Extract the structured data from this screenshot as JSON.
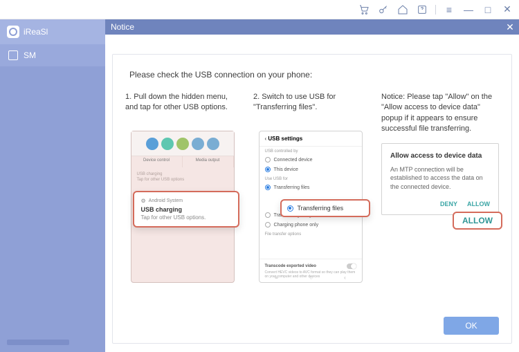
{
  "titlebar": {
    "icons": [
      "cart",
      "key",
      "home",
      "help"
    ]
  },
  "sidebar": {
    "brand": "iReaSl",
    "items": [
      {
        "label": "SM"
      }
    ]
  },
  "notice": {
    "title": "Notice"
  },
  "dialog": {
    "heading": "Please check the USB connection on your phone:",
    "ok": "OK"
  },
  "col1": {
    "instruction": "1. Pull down the hidden menu, and tap for other USB options.",
    "phone": {
      "row_left": "Device control",
      "row_right": "Media output",
      "faint1": "USB charging",
      "faint2": "Tap for other USB options",
      "callout_sys": "Android System",
      "callout_title": "USB charging",
      "callout_sub": "Tap for other USB options."
    }
  },
  "col2": {
    "instruction": "2. Switch to use USB for \"Transferring files\".",
    "phone": {
      "header": "USB settings",
      "sec1": "USB controlled by",
      "opt1": "Connected device",
      "opt2": "This device",
      "sec2": "Use USB for",
      "opt3": "Transferring files",
      "opt4": "Transferring images",
      "opt5": "Charging phone only",
      "sec3": "File transfer options",
      "trans_title": "Transcode exported video",
      "trans_desc": "Convert HEVC videos to AVC format so they can play them on your computer and other devices",
      "callout": "Transferring files"
    }
  },
  "col3": {
    "instruction": "Notice: Please tap \"Allow\" on the \"Allow access to device data\" popup if it appears to ensure successful file transferring.",
    "panel": {
      "title": "Allow access to device data",
      "desc": "An MTP connection will be established to access the data on the connected device.",
      "deny": "DENY",
      "allow": "ALLOW",
      "callout": "ALLOW"
    }
  }
}
